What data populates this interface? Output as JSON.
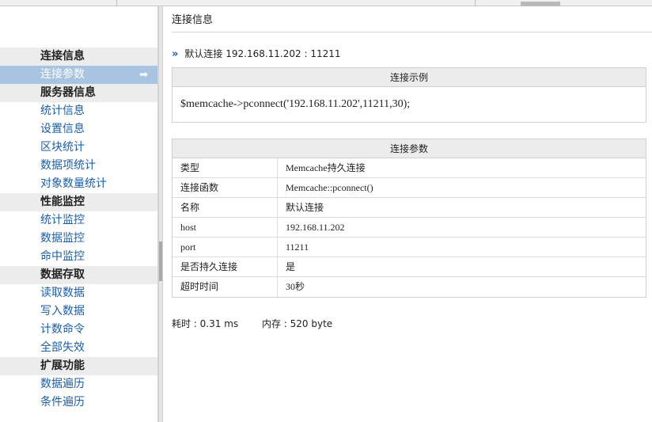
{
  "sidebar": {
    "sections": [
      {
        "title": "连接信息",
        "items": [
          {
            "label": "连接参数",
            "active": true
          }
        ]
      },
      {
        "title": "服务器信息",
        "items": [
          {
            "label": "统计信息"
          },
          {
            "label": "设置信息"
          },
          {
            "label": "区块统计"
          },
          {
            "label": "数据项统计"
          },
          {
            "label": "对象数量统计"
          }
        ]
      },
      {
        "title": "性能监控",
        "items": [
          {
            "label": "统计监控"
          },
          {
            "label": "数据监控"
          },
          {
            "label": "命中监控"
          }
        ]
      },
      {
        "title": "数据存取",
        "items": [
          {
            "label": "读取数据"
          },
          {
            "label": "写入数据"
          },
          {
            "label": "计数命令"
          },
          {
            "label": "全部失效"
          }
        ]
      },
      {
        "title": "扩展功能",
        "items": [
          {
            "label": "数据遍历"
          },
          {
            "label": "条件遍历"
          }
        ]
      }
    ],
    "active_arrow": "➡"
  },
  "main": {
    "title": "连接信息",
    "connection_marker": "»",
    "connection_line": "默认连接 192.168.11.202 : 11211",
    "example": {
      "header": "连接示例",
      "code": "$memcache->pconnect('192.168.11.202',11211,30);"
    },
    "params": {
      "header": "连接参数",
      "rows": [
        {
          "key": "类型",
          "value": "Memcache持久连接"
        },
        {
          "key": "连接函数",
          "value": "Memcache::pconnect()"
        },
        {
          "key": "名称",
          "value": "默认连接"
        },
        {
          "key": "host",
          "value": "192.168.11.202"
        },
        {
          "key": "port",
          "value": "11211"
        },
        {
          "key": "是否持久连接",
          "value": "是"
        },
        {
          "key": "超时时间",
          "value": "30秒"
        }
      ]
    },
    "stats": {
      "time": "耗时 : 0.31 ms",
      "memory": "内存 : 520 byte"
    }
  }
}
